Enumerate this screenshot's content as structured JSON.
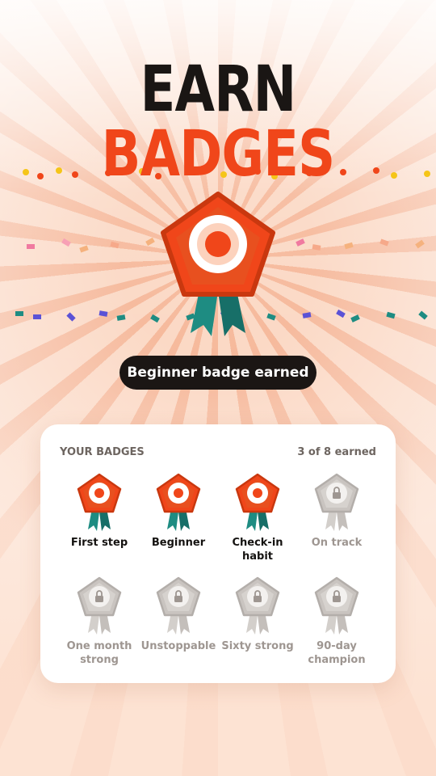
{
  "headline": {
    "line1": "EARN",
    "line2": "BADGES"
  },
  "banner": "Beginner badge earned",
  "colors": {
    "accent": "#f0461a",
    "dark": "#1b1614",
    "teal": "#1e8c82",
    "locked": "#c9c4c0"
  },
  "card": {
    "title": "YOUR BADGES",
    "count": "3 of 8 earned",
    "badges": [
      {
        "label": "First step",
        "earned": true
      },
      {
        "label": "Beginner",
        "earned": true
      },
      {
        "label": "Check-in habit",
        "earned": true
      },
      {
        "label": "On track",
        "earned": false
      },
      {
        "label": "One month strong",
        "earned": false
      },
      {
        "label": "Unstoppable",
        "earned": false
      },
      {
        "label": "Sixty strong",
        "earned": false
      },
      {
        "label": "90-day champion",
        "earned": false
      }
    ]
  }
}
